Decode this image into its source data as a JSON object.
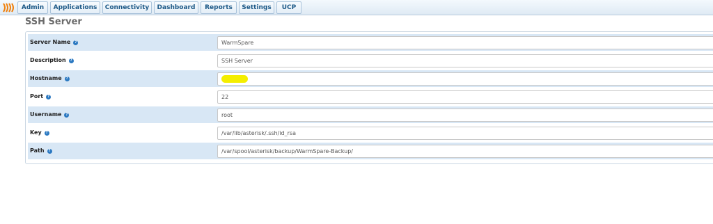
{
  "nav": {
    "tabs": [
      {
        "label": "Admin"
      },
      {
        "label": "Applications"
      },
      {
        "label": "Connectivity"
      },
      {
        "label": "Dashboard"
      },
      {
        "label": "Reports"
      },
      {
        "label": "Settings"
      },
      {
        "label": "UCP"
      }
    ]
  },
  "page": {
    "title": "SSH Server"
  },
  "form": {
    "fields": [
      {
        "label": "Server Name",
        "value": "WarmSpare"
      },
      {
        "label": "Description",
        "value": "SSH Server"
      },
      {
        "label": "Hostname",
        "value": ""
      },
      {
        "label": "Port",
        "value": "22"
      },
      {
        "label": "Username",
        "value": "root"
      },
      {
        "label": "Key",
        "value": "/var/lib/asterisk/.ssh/id_rsa"
      },
      {
        "label": "Path",
        "value": "/var/spool/asterisk/backup/WarmSpare-Backup/"
      }
    ]
  },
  "colors": {
    "accent": "#1d5987",
    "row_shade": "#d8e7f5",
    "help_icon": "#2a78c1",
    "redaction": "#f4ee00",
    "logo": "#f0820f"
  }
}
